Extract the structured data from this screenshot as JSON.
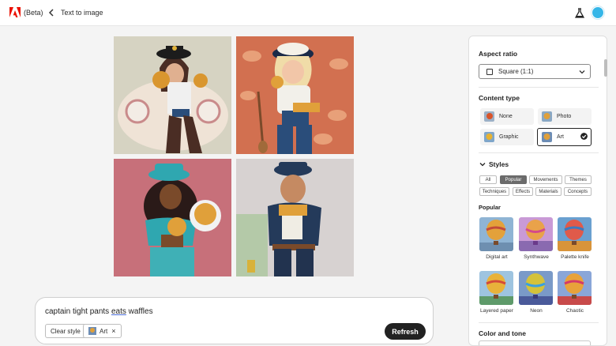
{
  "header": {
    "beta_label": "(Beta)",
    "breadcrumb": "Text to image",
    "icons": [
      "adobe-logo",
      "back-chevron-icon",
      "flask-icon",
      "avatar"
    ]
  },
  "prompt": {
    "before": "captain tight pants ",
    "underlined": "eats",
    "after": " waffles",
    "clear_style_label": "Clear style",
    "style_chip_label": "Art",
    "style_chip_remove": "×",
    "refresh_label": "Refresh"
  },
  "panel": {
    "aspect_ratio": {
      "heading": "Aspect ratio",
      "selected": "Square (1:1)"
    },
    "content_type": {
      "heading": "Content type",
      "options": [
        {
          "label": "None",
          "selected": false
        },
        {
          "label": "Photo",
          "selected": false
        },
        {
          "label": "Graphic",
          "selected": false
        },
        {
          "label": "Art",
          "selected": true
        }
      ]
    },
    "styles": {
      "heading": "Styles",
      "tags": [
        "All",
        "Popular",
        "Movements",
        "Themes",
        "Techniques",
        "Effects",
        "Materials",
        "Concepts"
      ],
      "selected_tag": "Popular",
      "subheading": "Popular",
      "items": [
        {
          "label": "Digital art"
        },
        {
          "label": "Synthwave"
        },
        {
          "label": "Palette knife"
        },
        {
          "label": "Layered paper"
        },
        {
          "label": "Neon"
        },
        {
          "label": "Chaotic"
        }
      ]
    },
    "color_and_tone": {
      "heading": "Color and tone"
    }
  },
  "colors": {
    "accent": "#222222",
    "avatar": "#35b6e8",
    "adobe_red": "#eb1000"
  }
}
